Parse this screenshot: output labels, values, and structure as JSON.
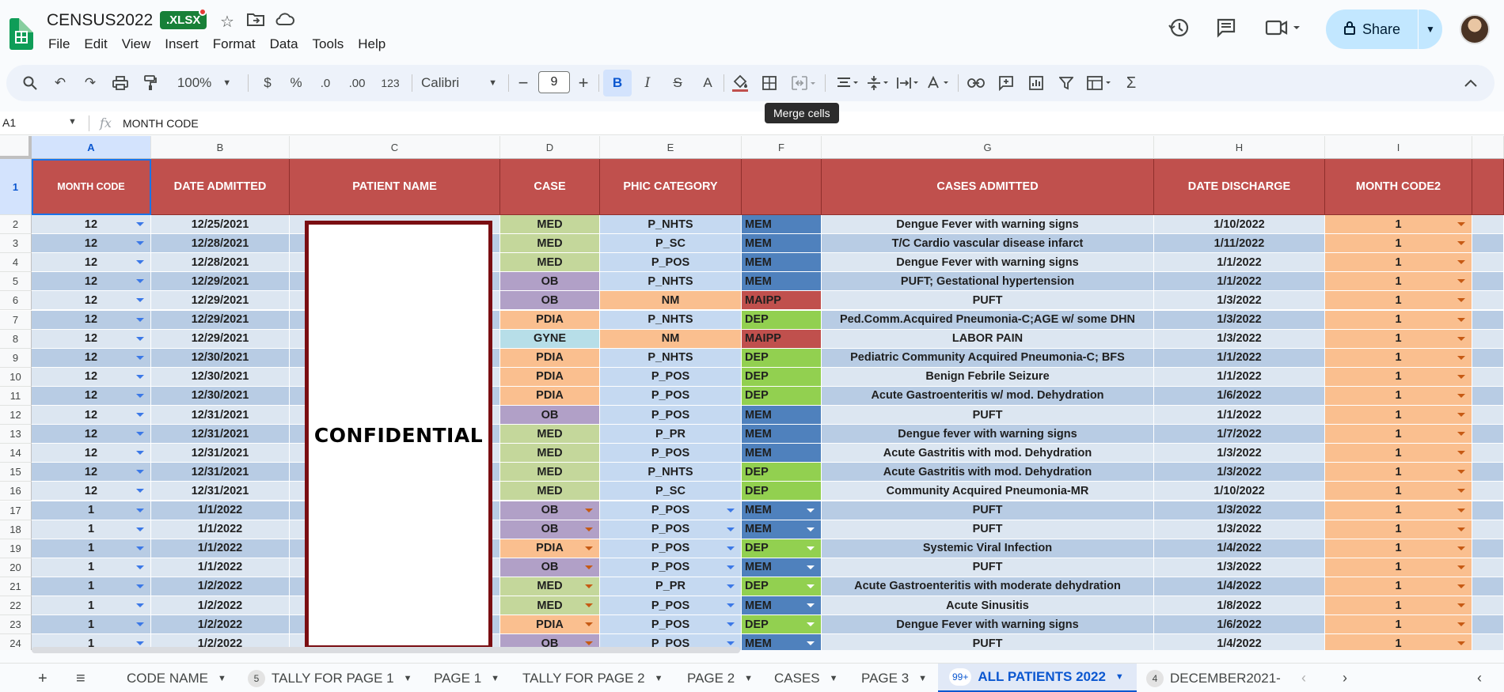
{
  "header": {
    "doc_title": "CENSUS2022",
    "file_badge": ".XLSX",
    "menus": [
      "File",
      "Edit",
      "View",
      "Insert",
      "Format",
      "Data",
      "Tools",
      "Help"
    ],
    "share_label": "Share"
  },
  "toolbar": {
    "zoom": "100%",
    "currency": "$",
    "percent": "%",
    "dec_decrease": ".0",
    "dec_increase": ".00",
    "number_format": "123",
    "font": "Calibri",
    "font_size": "9",
    "tooltip": "Merge cells"
  },
  "formula_bar": {
    "cell_ref": "A1",
    "content": "MONTH CODE"
  },
  "grid": {
    "columns": [
      "A",
      "B",
      "C",
      "D",
      "E",
      "F",
      "G",
      "H",
      "I"
    ],
    "header_row": [
      "MONTH CODE",
      "DATE ADMITTED",
      "PATIENT NAME",
      "CASE",
      "PHIC CATEGORY",
      "",
      "CASES ADMITTED",
      "DATE DISCHARGE",
      "MONTH CODE2"
    ],
    "confidential_label": "CONFIDENTIAL",
    "rows": [
      {
        "n": "2",
        "a": "12",
        "b": "12/25/2021",
        "d": "MED",
        "e": "P_NHTS",
        "f": "MEM",
        "g": "Dengue Fever with warning signs",
        "h": "1/10/2022",
        "i": "1"
      },
      {
        "n": "3",
        "a": "12",
        "b": "12/28/2021",
        "d": "MED",
        "e": "P_SC",
        "f": "MEM",
        "g": "T/C Cardio vascular disease infarct",
        "h": "1/11/2022",
        "i": "1"
      },
      {
        "n": "4",
        "a": "12",
        "b": "12/28/2021",
        "d": "MED",
        "e": "P_POS",
        "f": "MEM",
        "g": "Dengue Fever with warning signs",
        "h": "1/1/2022",
        "i": "1"
      },
      {
        "n": "5",
        "a": "12",
        "b": "12/29/2021",
        "d": "OB",
        "e": "P_NHTS",
        "f": "MEM",
        "g": "PUFT; Gestational hypertension",
        "h": "1/1/2022",
        "i": "1"
      },
      {
        "n": "6",
        "a": "12",
        "b": "12/29/2021",
        "d": "OB",
        "e": "NM",
        "f": "MAIPP",
        "g": "PUFT",
        "h": "1/3/2022",
        "i": "1"
      },
      {
        "n": "7",
        "a": "12",
        "b": "12/29/2021",
        "d": "PDIA",
        "e": "P_NHTS",
        "f": "DEP",
        "g": "Ped.Comm.Acquired Pneumonia-C;AGE w/ some DHN",
        "h": "1/3/2022",
        "i": "1"
      },
      {
        "n": "8",
        "a": "12",
        "b": "12/29/2021",
        "d": "GYNE",
        "e": "NM",
        "f": "MAIPP",
        "g": "LABOR PAIN",
        "h": "1/3/2022",
        "i": "1"
      },
      {
        "n": "9",
        "a": "12",
        "b": "12/30/2021",
        "d": "PDIA",
        "e": "P_NHTS",
        "f": "DEP",
        "g": "Pediatric Community Acquired Pneumonia-C; BFS",
        "h": "1/1/2022",
        "i": "1"
      },
      {
        "n": "10",
        "a": "12",
        "b": "12/30/2021",
        "d": "PDIA",
        "e": "P_POS",
        "f": "DEP",
        "g": "Benign Febrile Seizure",
        "h": "1/1/2022",
        "i": "1"
      },
      {
        "n": "11",
        "a": "12",
        "b": "12/30/2021",
        "d": "PDIA",
        "e": "P_POS",
        "f": "DEP",
        "g": "Acute Gastroenteritis w/ mod. Dehydration",
        "h": "1/6/2022",
        "i": "1"
      },
      {
        "n": "12",
        "a": "12",
        "b": "12/31/2021",
        "d": "OB",
        "e": "P_POS",
        "f": "MEM",
        "g": "PUFT",
        "h": "1/1/2022",
        "i": "1"
      },
      {
        "n": "13",
        "a": "12",
        "b": "12/31/2021",
        "d": "MED",
        "e": "P_PR",
        "f": "MEM",
        "g": "Dengue fever with warning signs",
        "h": "1/7/2022",
        "i": "1"
      },
      {
        "n": "14",
        "a": "12",
        "b": "12/31/2021",
        "d": "MED",
        "e": "P_POS",
        "f": "MEM",
        "g": "Acute Gastritis with mod. Dehydration",
        "h": "1/3/2022",
        "i": "1"
      },
      {
        "n": "15",
        "a": "12",
        "b": "12/31/2021",
        "d": "MED",
        "e": "P_NHTS",
        "f": "DEP",
        "g": "Acute Gastritis with mod. Dehydration",
        "h": "1/3/2022",
        "i": "1"
      },
      {
        "n": "16",
        "a": "12",
        "b": "12/31/2021",
        "d": "MED",
        "e": "P_SC",
        "f": "DEP",
        "g": "Community Acquired Pneumonia-MR",
        "h": "1/10/2022",
        "i": "1"
      },
      {
        "n": "17",
        "a": "1",
        "b": "1/1/2022",
        "d": "OB",
        "e": "P_POS",
        "f": "MEM",
        "g": "PUFT",
        "h": "1/3/2022",
        "i": "1"
      },
      {
        "n": "18",
        "a": "1",
        "b": "1/1/2022",
        "d": "OB",
        "e": "P_POS",
        "f": "MEM",
        "g": "PUFT",
        "h": "1/3/2022",
        "i": "1"
      },
      {
        "n": "19",
        "a": "1",
        "b": "1/1/2022",
        "d": "PDIA",
        "e": "P_POS",
        "f": "DEP",
        "g": "Systemic Viral Infection",
        "h": "1/4/2022",
        "i": "1"
      },
      {
        "n": "20",
        "a": "1",
        "b": "1/1/2022",
        "d": "OB",
        "e": "P_POS",
        "f": "MEM",
        "g": "PUFT",
        "h": "1/3/2022",
        "i": "1"
      },
      {
        "n": "21",
        "a": "1",
        "b": "1/2/2022",
        "d": "MED",
        "e": "P_PR",
        "f": "DEP",
        "g": "Acute Gastroenteritis with moderate dehydration",
        "h": "1/4/2022",
        "i": "1"
      },
      {
        "n": "22",
        "a": "1",
        "b": "1/2/2022",
        "d": "MED",
        "e": "P_POS",
        "f": "MEM",
        "g": "Acute Sinusitis",
        "h": "1/8/2022",
        "i": "1"
      },
      {
        "n": "23",
        "a": "1",
        "b": "1/2/2022",
        "d": "PDIA",
        "e": "P_POS",
        "f": "DEP",
        "g": "Dengue Fever with warning signs",
        "h": "1/6/2022",
        "i": "1"
      },
      {
        "n": "24",
        "a": "1",
        "b": "1/2/2022",
        "d": "OB",
        "e": "P_POS",
        "f": "MEM",
        "g": "PUFT",
        "h": "1/4/2022",
        "i": "1"
      }
    ]
  },
  "sheet_tabs": [
    {
      "label": "CODE NAME",
      "badge": ""
    },
    {
      "label": "TALLY FOR PAGE 1",
      "badge": "5"
    },
    {
      "label": "PAGE 1",
      "badge": ""
    },
    {
      "label": "TALLY FOR PAGE 2",
      "badge": ""
    },
    {
      "label": "PAGE 2",
      "badge": ""
    },
    {
      "label": "CASES",
      "badge": ""
    },
    {
      "label": "PAGE 3",
      "badge": ""
    },
    {
      "label": "ALL PATIENTS 2022",
      "badge": "99+",
      "active": true
    },
    {
      "label": "DECEMBER2021-",
      "badge": "4"
    }
  ],
  "colors": {
    "header_red": "#c0504d",
    "case_med": "#c4d79b",
    "case_ob": "#b1a0c7",
    "case_pdia": "#fabf8f",
    "case_gyne": "#b7dee8",
    "phic_blue": "#c5d9f1",
    "phic_nm": "#fabf8f",
    "mem_blue": "#4f81bd",
    "dep_green": "#92d050",
    "maipp_red": "#c0504d",
    "month2_orange": "#fabf8f",
    "row_band_a": "#dce6f1",
    "row_band_b": "#b8cce4",
    "accent": "#0b57d0"
  }
}
